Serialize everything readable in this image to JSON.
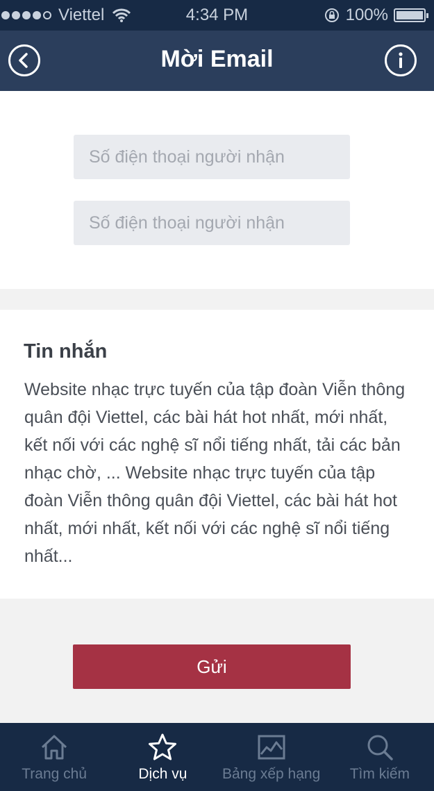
{
  "status_bar": {
    "carrier": "Viettel",
    "time": "4:34 PM",
    "battery": "100%"
  },
  "header": {
    "title": "Mời Email",
    "back_icon": "back-circle-icon",
    "info_icon": "info-circle-icon"
  },
  "form": {
    "field1_placeholder": "Số điện thoại người nhận",
    "field2_placeholder": "Số điện thoại người nhận"
  },
  "message": {
    "heading": "Tin nhắn",
    "body": "Website nhạc trực tuyến của tập đoàn Viễn thông quân đội Viettel, các bài hát hot nhất, mới nhất, kết nối với các nghệ sĩ nổi tiếng nhất, tải các bản nhạc chờ, ... Website nhạc trực tuyến của tập đoàn Viễn thông quân đội Viettel, các bài hát hot nhất, mới nhất, kết nối với các nghệ sĩ nổi tiếng nhất..."
  },
  "send_button": "Gửi",
  "tabs": [
    {
      "label": "Trang chủ",
      "icon": "home-icon",
      "active": false
    },
    {
      "label": "Dịch vụ",
      "icon": "star-icon",
      "active": true
    },
    {
      "label": "Bảng xếp hạng",
      "icon": "chart-image-icon",
      "active": false
    },
    {
      "label": "Tìm kiếm",
      "icon": "search-icon",
      "active": false
    }
  ],
  "colors": {
    "nav_bg": "#2b3e5c",
    "tab_bg": "#172a45",
    "accent": "#a53244"
  }
}
